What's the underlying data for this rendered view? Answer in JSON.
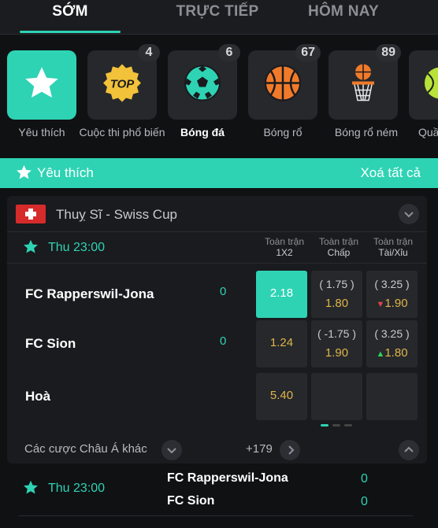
{
  "tabs": {
    "early": "SỚM",
    "live": "TRỰC TIẾP",
    "today": "HÔM NAY"
  },
  "categories": [
    {
      "label": "Yêu thích",
      "badge": "",
      "icon": "star-icon"
    },
    {
      "label": "Cuộc thi phổ biến",
      "badge": "4",
      "icon": "top-badge-icon",
      "icon_text": "TOP"
    },
    {
      "label": "Bóng đá",
      "badge": "6",
      "icon": "soccer-ball-icon"
    },
    {
      "label": "Bóng rổ",
      "badge": "67",
      "icon": "basketball-icon"
    },
    {
      "label": "Bóng rổ ném",
      "badge": "89",
      "icon": "basketball-hoop-icon"
    },
    {
      "label": "Quầ",
      "badge": "",
      "icon": "tennis-ball-icon"
    }
  ],
  "favorites_bar": {
    "title": "Yêu thích",
    "clear": "Xoá tất cả"
  },
  "match": {
    "league": "Thuỵ Sĩ - Swiss Cup",
    "time": "Thu 23:00",
    "columns": [
      {
        "line1": "Toàn trận",
        "line2": "1X2"
      },
      {
        "line1": "Toàn trận",
        "line2": "Chấp"
      },
      {
        "line1": "Toàn trận",
        "line2": "Tài/Xỉu"
      }
    ],
    "rows": [
      {
        "team": "FC Rapperswil-Jona",
        "score": "0",
        "x12": "2.18",
        "hcap_line": "( 1.75 )",
        "hcap_odds": "1.80",
        "ou_line": "( 3.25 )",
        "ou_odds": "1.90",
        "ou_trend": "▼"
      },
      {
        "team": "FC Sion",
        "score": "0",
        "x12": "1.24",
        "hcap_line": "( -1.75 )",
        "hcap_odds": "1.90",
        "ou_line": "( 3.25 )",
        "ou_odds": "1.80",
        "ou_trend": "▲"
      },
      {
        "team": "Hoà",
        "score": "",
        "x12": "5.40"
      }
    ],
    "more_label": "Các cược Châu Á khác",
    "more_count": "+179"
  },
  "next_match": {
    "time": "Thu 23:00",
    "home": "FC Rapperswil-Jona",
    "away": "FC Sion",
    "home_score": "0",
    "away_score": "0"
  },
  "colors": {
    "accent": "#2ed3b4",
    "odds": "#e0b548",
    "down": "#e04646",
    "up": "#2ed35c",
    "flag": "#d62b2b"
  }
}
